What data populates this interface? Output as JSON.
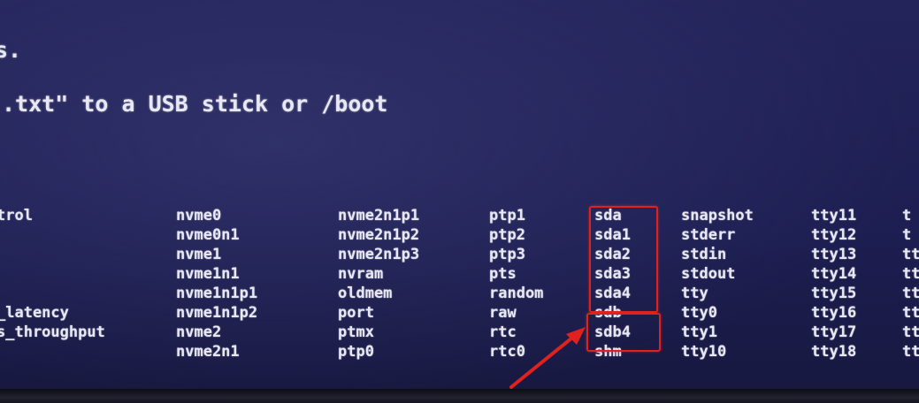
{
  "console": {
    "line1": "s.",
    "line2": ".txt\" to a USB stick or /boot"
  },
  "dev_columns": [
    [
      "trol",
      "",
      "",
      "",
      "",
      "_latency",
      "s_throughput",
      ""
    ],
    [
      "nvme0",
      "nvme0n1",
      "nvme1",
      "nvme1n1",
      "nvme1n1p1",
      "nvme1n1p2",
      "nvme2",
      "nvme2n1"
    ],
    [
      "nvme2n1p1",
      "nvme2n1p2",
      "nvme2n1p3",
      "nvram",
      "oldmem",
      "port",
      "ptmx",
      "ptp0"
    ],
    [
      "ptp1",
      "ptp2",
      "ptp3",
      "pts",
      "random",
      "raw",
      "rtc",
      "rtc0"
    ],
    [
      "sda",
      "sda1",
      "sda2",
      "sda3",
      "sda4",
      "sdb",
      "sdb4",
      "shm"
    ],
    [
      "snapshot",
      "stderr",
      "stdin",
      "stdout",
      "tty",
      "tty0",
      "tty1",
      "tty10"
    ],
    [
      "tty11",
      "tty12",
      "tty13",
      "tty14",
      "tty15",
      "tty16",
      "tty17",
      "tty18"
    ],
    [
      "t",
      "t",
      "tt",
      "tt",
      "tt",
      "tty",
      "tty",
      "tty"
    ]
  ],
  "annotation_color": "#e0221f",
  "screen_color": "#1c1d4c"
}
